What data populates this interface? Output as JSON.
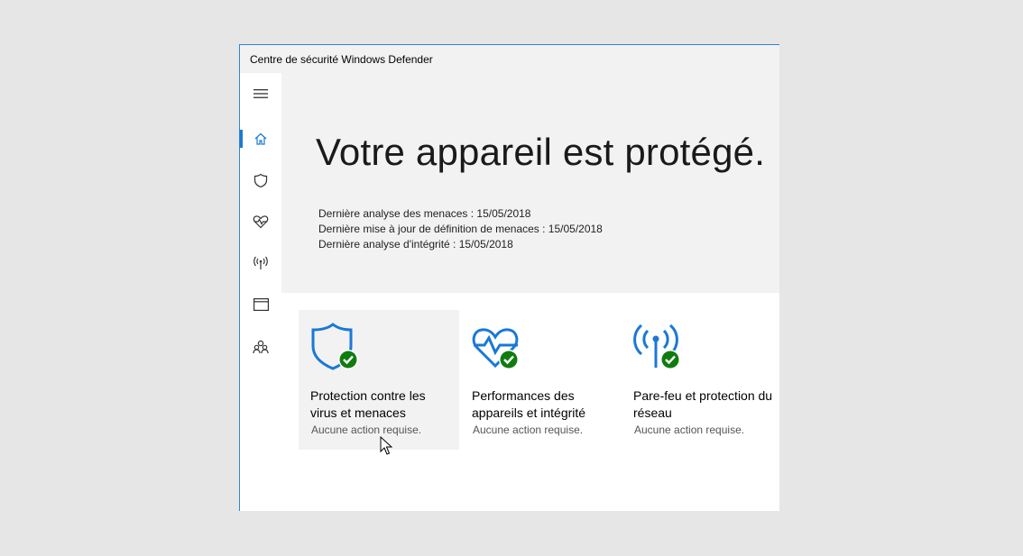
{
  "window": {
    "title": "Centre de sécurité Windows Defender"
  },
  "nav": {
    "items": [
      {
        "name": "menu",
        "icon": "hamburger-menu-icon"
      },
      {
        "name": "home",
        "icon": "home-icon",
        "active": true
      },
      {
        "name": "virus",
        "icon": "shield-icon"
      },
      {
        "name": "health",
        "icon": "heart-pulse-icon"
      },
      {
        "name": "network",
        "icon": "antenna-icon"
      },
      {
        "name": "app-browser",
        "icon": "browser-window-icon"
      },
      {
        "name": "family",
        "icon": "family-icon"
      }
    ]
  },
  "hero": {
    "title": "Votre appareil est protégé.",
    "lines": [
      "Dernière analyse des menaces : 15/05/2018",
      "Dernière mise à jour de définition de menaces : 15/05/2018",
      "Dernière analyse d'intégrité : 15/05/2018"
    ]
  },
  "tiles": [
    {
      "title": "Protection contre les virus et menaces",
      "status": "Aucune action requise.",
      "icon": "shield-check-icon"
    },
    {
      "title": "Performances des appareils et intégrité",
      "status": "Aucune action requise.",
      "icon": "heart-check-icon"
    },
    {
      "title": "Pare-feu et protection du réseau",
      "status": "Aucune action requise.",
      "icon": "antenna-check-icon"
    }
  ],
  "colors": {
    "accent": "#1a78d6",
    "ok": "#107c10",
    "hero_bg": "#f2f2f2"
  }
}
